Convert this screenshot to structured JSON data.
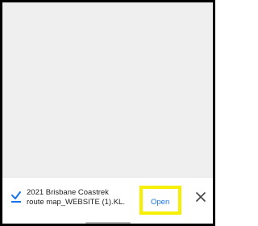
{
  "download": {
    "file_name_line1": "2021 Brisbane Coastrek",
    "file_name_line2_prefix": "route map_WEBSITE (1).K",
    "file_name_line2_suffix": "L.",
    "open_label": "Open",
    "icon": "download-complete-icon",
    "close_icon": "close-icon"
  },
  "colors": {
    "accent": "#1a73e8",
    "highlight": "#f6f000",
    "background": "#efefef"
  }
}
